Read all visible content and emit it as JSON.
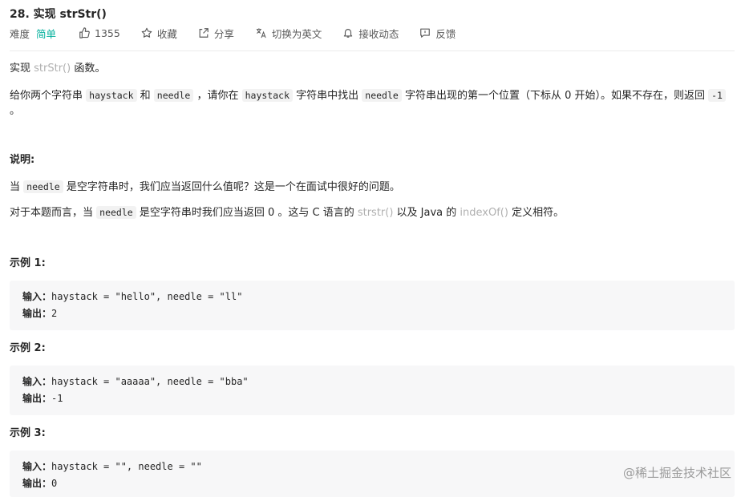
{
  "header": {
    "title": "28. 实现 strStr()",
    "difficulty_label": "难度",
    "difficulty_value": "简单",
    "likes": "1355",
    "favorite": "收藏",
    "share": "分享",
    "switch_lang": "切换为英文",
    "subscribe": "接收动态",
    "feedback": "反馈"
  },
  "description": {
    "line1_a": "实现 ",
    "line1_link": "strStr()",
    "line1_b": " 函数。",
    "line2_a": "给你两个字符串 ",
    "code_haystack": "haystack",
    "line2_b": " 和 ",
    "code_needle": "needle",
    "line2_c": " ，请你在 ",
    "line2_d": " 字符串中找出 ",
    "line2_e": " 字符串出现的第一个位置（下标从 0 开始）。如果不存在，则返回 ",
    "code_neg1": "-1",
    "line2_end": "。"
  },
  "notes": {
    "heading": "说明:",
    "line1_a": "当 ",
    "line1_b": " 是空字符串时，我们应当返回什么值呢？这是一个在面试中很好的问题。",
    "line2_a": "对于本题而言，当 ",
    "line2_b": " 是空字符串时我们应当返回 0 。这与 C 语言的 ",
    "link_strstr": "strstr()",
    "line2_c": " 以及 Java 的 ",
    "link_indexof": "indexOf()",
    "line2_d": " 定义相符。"
  },
  "examples": [
    {
      "heading": "示例 1:",
      "input_label": "输入：",
      "input": "haystack = \"hello\", needle = \"ll\"",
      "output_label": "输出：",
      "output": "2"
    },
    {
      "heading": "示例 2:",
      "input_label": "输入：",
      "input": "haystack = \"aaaaa\", needle = \"bba\"",
      "output_label": "输出：",
      "output": "-1"
    },
    {
      "heading": "示例 3:",
      "input_label": "输入：",
      "input": "haystack = \"\", needle = \"\"",
      "output_label": "输出：",
      "output": "0"
    }
  ],
  "watermark": "@稀土掘金技术社区"
}
